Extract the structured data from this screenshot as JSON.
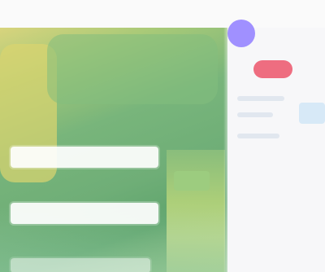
{
  "app": {
    "accent_color": "#a090ff",
    "panel_colors": {
      "yellow": "#d9d46f",
      "green": "#78b57b",
      "light_green": "#c5dc8e"
    },
    "badge_color": "#ee6d80"
  },
  "topbar": {
    "avatar_icon": "avatar"
  },
  "main_panel": {
    "field_count": 3
  },
  "right_panel": {
    "badge_icon": "status-badge"
  }
}
